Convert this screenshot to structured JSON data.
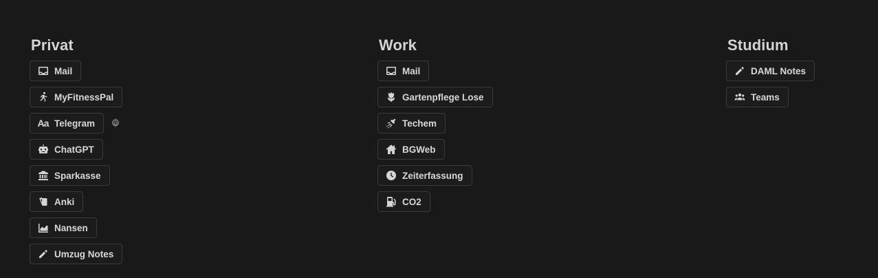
{
  "columns": {
    "privat": {
      "title": "Privat",
      "items": [
        {
          "label": "Mail",
          "icon": "inbox-icon"
        },
        {
          "label": "MyFitnessPal",
          "icon": "running-icon"
        },
        {
          "label": "Telegram",
          "icon": "text-aa-icon"
        },
        {
          "label": "ChatGPT",
          "icon": "robot-icon"
        },
        {
          "label": "Sparkasse",
          "icon": "bank-icon"
        },
        {
          "label": "Anki",
          "icon": "cards-icon"
        },
        {
          "label": "Nansen",
          "icon": "chart-icon"
        },
        {
          "label": "Umzug Notes",
          "icon": "pencil-icon"
        }
      ],
      "text_icon": "Aa"
    },
    "work": {
      "title": "Work",
      "items": [
        {
          "label": "Mail",
          "icon": "inbox-icon"
        },
        {
          "label": "Gartenpflege Lose",
          "icon": "flower-icon"
        },
        {
          "label": "Techem",
          "icon": "shower-icon"
        },
        {
          "label": "BGWeb",
          "icon": "home-icon"
        },
        {
          "label": "Zeiterfassung",
          "icon": "clock-icon"
        },
        {
          "label": "CO2",
          "icon": "fuel-icon"
        }
      ]
    },
    "studium": {
      "title": "Studium",
      "items": [
        {
          "label": "DAML Notes",
          "icon": "pencil-icon"
        },
        {
          "label": "Teams",
          "icon": "people-icon"
        }
      ]
    }
  }
}
